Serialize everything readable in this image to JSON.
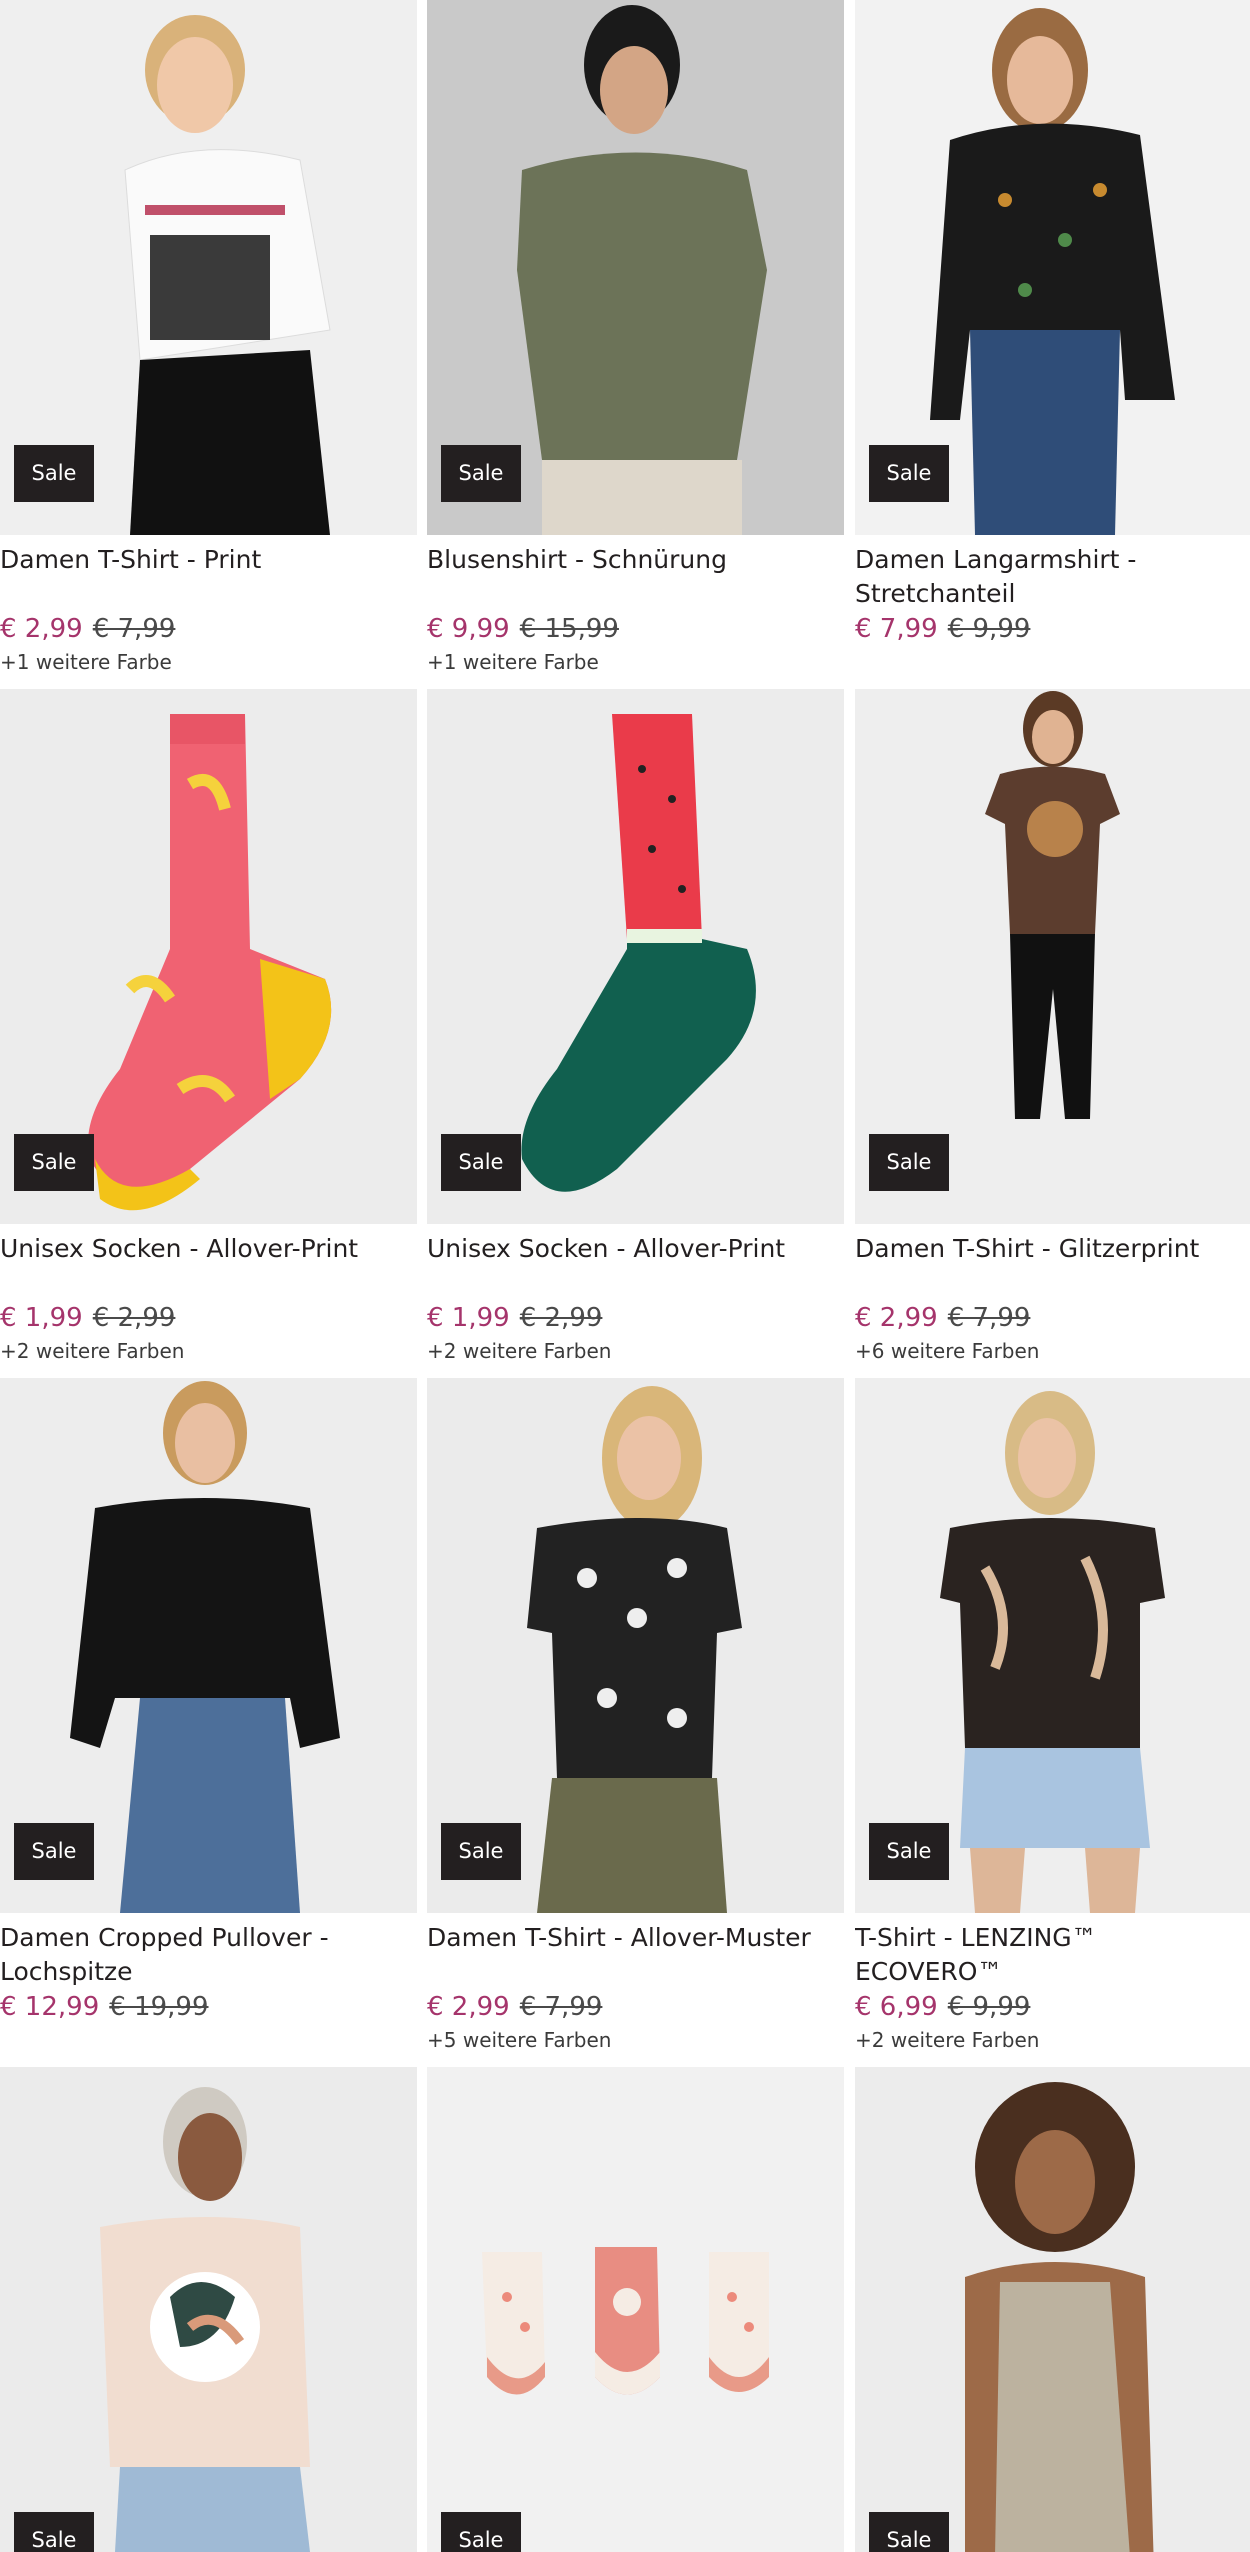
{
  "sale_label": "Sale",
  "colors": {
    "price_accent": "#a5346b",
    "badge_bg": "#231f20"
  },
  "products": [
    {
      "title": "Damen T-Shirt - Print",
      "price": "€ 2,99",
      "old_price": "€ 7,99",
      "colors": "+1 weitere Farbe",
      "image": "woman-white-print-tshirt"
    },
    {
      "title": "Blusenshirt - Schnürung",
      "price": "€ 9,99",
      "old_price": "€ 15,99",
      "colors": "+1 weitere Farbe",
      "image": "woman-olive-blouse"
    },
    {
      "title": "Damen Langarmshirt - Stretchanteil",
      "price": "€ 7,99",
      "old_price": "€ 9,99",
      "colors": "",
      "image": "woman-black-floral-longsleeve"
    },
    {
      "title": "Unisex Socken - Allover-Print",
      "price": "€ 1,99",
      "old_price": "€ 2,99",
      "colors": "+2 weitere Farben",
      "image": "banana-sock"
    },
    {
      "title": "Unisex Socken - Allover-Print",
      "price": "€ 1,99",
      "old_price": "€ 2,99",
      "colors": "+2 weitere Farben",
      "image": "watermelon-sock"
    },
    {
      "title": "Damen T-Shirt - Glitzerprint",
      "price": "€ 2,99",
      "old_price": "€ 7,99",
      "colors": "+6 weitere Farben",
      "image": "woman-brown-tshirt"
    },
    {
      "title": "Damen Cropped Pullover - Lochspitze",
      "price": "€ 12,99",
      "old_price": "€ 19,99",
      "colors": "",
      "image": "woman-black-crochet-pullover"
    },
    {
      "title": "Damen T-Shirt - Allover-Muster",
      "price": "€ 2,99",
      "old_price": "€ 7,99",
      "colors": "+5 weitere Farben",
      "image": "woman-leopard-tshirt"
    },
    {
      "title": "T-Shirt - LENZING™ ECOVERO™",
      "price": "€ 6,99",
      "old_price": "€ 9,99",
      "colors": "+2 weitere Farben",
      "image": "woman-leaf-print-tshirt"
    },
    {
      "title": "",
      "price": "",
      "old_price": "",
      "colors": "",
      "image": "woman-beige-tshirt"
    },
    {
      "title": "",
      "price": "",
      "old_price": "",
      "colors": "",
      "image": "three-pairs-heart-socks"
    },
    {
      "title": "",
      "price": "",
      "old_price": "",
      "colors": "",
      "image": "woman-taupe-tank-top"
    }
  ]
}
